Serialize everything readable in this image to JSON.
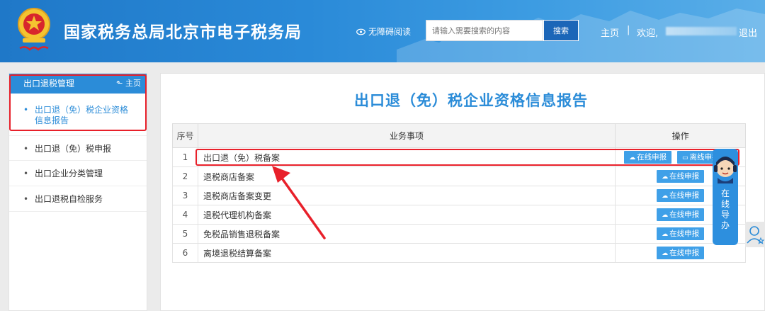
{
  "header": {
    "title": "国家税务总局北京市电子税务局",
    "accessibility_label": "无障碍阅读",
    "search_placeholder": "请输入需要搜索的内容",
    "search_button": "搜索",
    "nav_home": "主页",
    "nav_separator": "|",
    "nav_welcome": "欢迎,",
    "nav_logout": "退出"
  },
  "sidebar": {
    "header_title": "出口退税管理",
    "header_home": "主页",
    "items": [
      {
        "label_line1": "出口退（免）税企业资格",
        "label_line2": "信息报告",
        "active": true
      },
      {
        "label": "出口退（免）税申报"
      },
      {
        "label": "出口企业分类管理"
      },
      {
        "label": "出口退税自检服务"
      }
    ]
  },
  "main": {
    "title": "出口退（免）税企业资格信息报告",
    "columns": [
      "序号",
      "业务事项",
      "操作"
    ],
    "rows": [
      {
        "no": "1",
        "item": "出口退（免）税备案",
        "actions": [
          "在线申报",
          "离线申报"
        ]
      },
      {
        "no": "2",
        "item": "退税商店备案",
        "actions": [
          "在线申报"
        ]
      },
      {
        "no": "3",
        "item": "退税商店备案变更",
        "actions": [
          "在线申报"
        ]
      },
      {
        "no": "4",
        "item": "退税代理机构备案",
        "actions": [
          "在线申报"
        ]
      },
      {
        "no": "5",
        "item": "免税品销售退税备案",
        "actions": [
          "在线申报"
        ]
      },
      {
        "no": "6",
        "item": "离境退税结算备案",
        "actions": [
          "在线申报"
        ]
      }
    ]
  },
  "assistant": {
    "label": "在线导办"
  },
  "colors": {
    "brand_blue": "#2b8cd8",
    "annotation_red": "#e8202a",
    "button_blue": "#3fa0e8"
  }
}
